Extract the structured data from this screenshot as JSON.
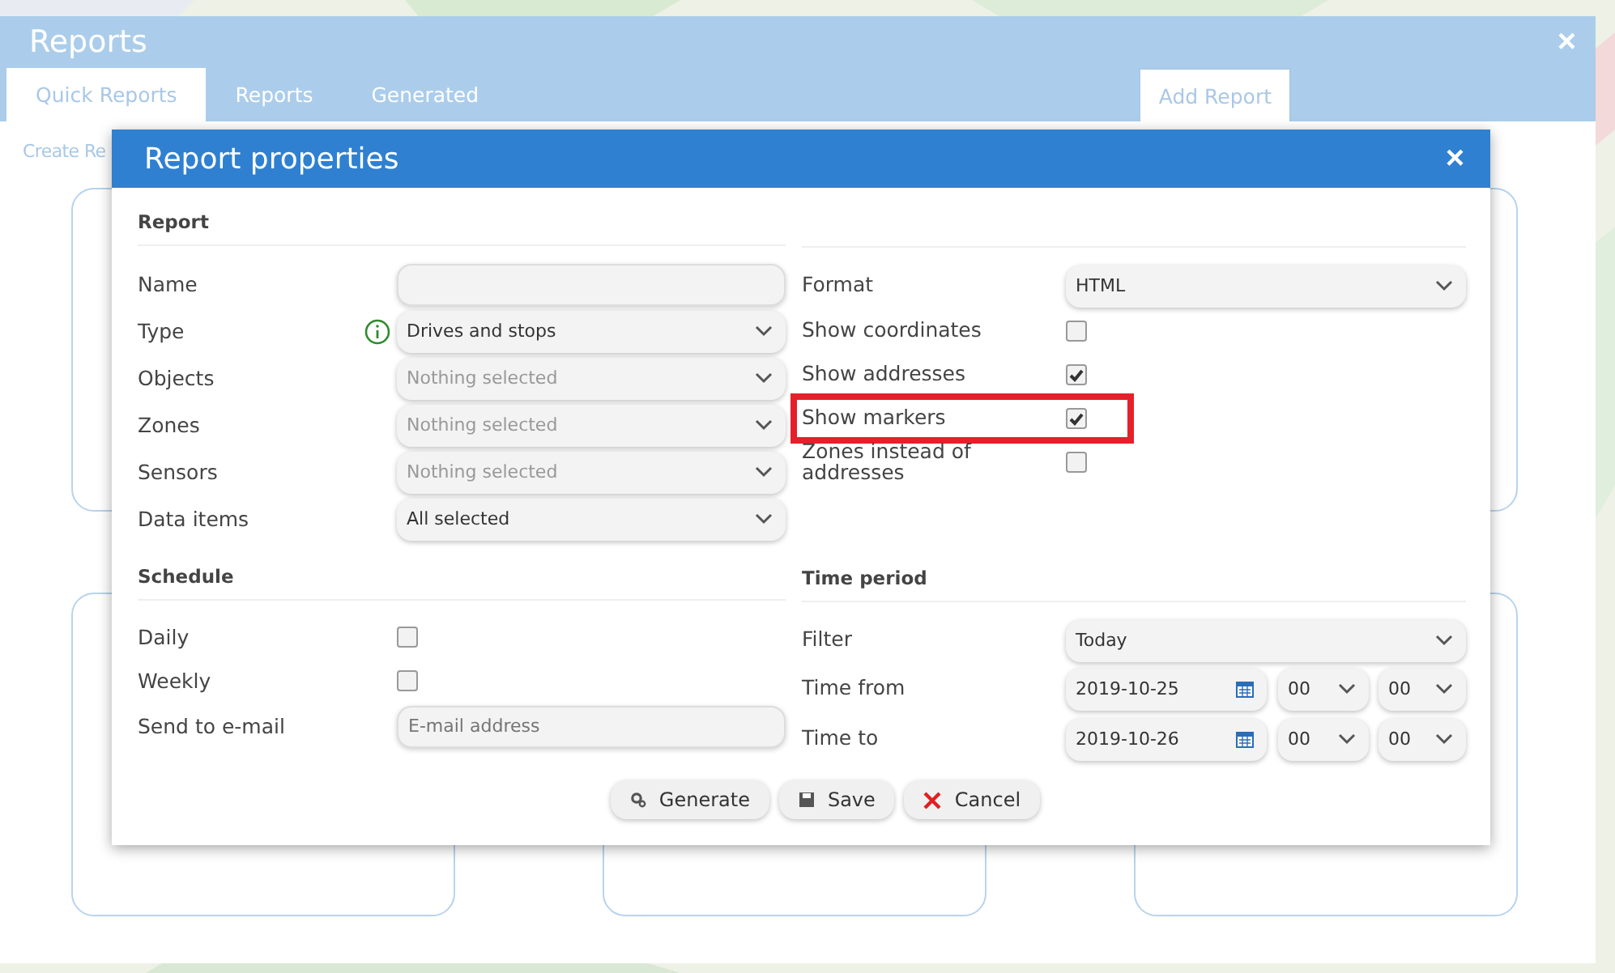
{
  "window": {
    "title": "Reports",
    "close": "×"
  },
  "tabs": [
    {
      "label": "Quick Reports",
      "selected": true
    },
    {
      "label": "Reports",
      "selected": false
    },
    {
      "label": "Generated",
      "selected": false
    }
  ],
  "add_button": "Add Report",
  "create_link": "Create Re",
  "cards": [
    {
      "kind": "card"
    },
    {
      "kind": "card"
    },
    {
      "kind": "card"
    },
    {
      "kind": "card"
    },
    {
      "kind": "card"
    }
  ],
  "dialog": {
    "title": "Report properties",
    "close": "×",
    "report_section": "Report",
    "report_fields": [
      {
        "label": "Name",
        "kind": "input",
        "info": false
      },
      {
        "label": "Type",
        "kind": "select",
        "value": "Drives and stops",
        "muted": false,
        "info": true
      },
      {
        "label": "Objects",
        "kind": "select",
        "value": "Nothing selected",
        "muted": true,
        "info": false
      },
      {
        "label": "Zones",
        "kind": "select",
        "value": "Nothing selected",
        "muted": true,
        "info": false
      },
      {
        "label": "Sensors",
        "kind": "select",
        "value": "Nothing selected",
        "muted": true,
        "info": false
      },
      {
        "label": "Data items",
        "kind": "select",
        "value": "All selected",
        "muted": false,
        "info": false
      }
    ],
    "format": {
      "label": "Format",
      "value": "HTML"
    },
    "options": [
      {
        "label": "Show coordinates",
        "checked": false,
        "highlighted": false
      },
      {
        "label": "Show addresses",
        "checked": true,
        "highlighted": false
      },
      {
        "label": "Show markers",
        "checked": true,
        "highlighted": true
      },
      {
        "label": "Zones instead of addresses",
        "checked": false,
        "highlighted": false
      }
    ],
    "schedule_section": "Schedule",
    "schedule": [
      {
        "label": "Daily",
        "checked": false
      },
      {
        "label": "Weekly",
        "checked": false
      }
    ],
    "email": {
      "label": "Send to e-mail",
      "placeholder": "E-mail address"
    },
    "period_section": "Time period",
    "filter": {
      "label": "Filter",
      "value": "Today"
    },
    "times": [
      {
        "label": "Time from",
        "date": "2019-10-25",
        "hour": "00",
        "minute": "00"
      },
      {
        "label": "Time to",
        "date": "2019-10-26",
        "hour": "00",
        "minute": "00"
      }
    ],
    "buttons": [
      {
        "label": "Generate",
        "kind": "generate"
      },
      {
        "label": "Save",
        "kind": "save"
      },
      {
        "label": "Cancel",
        "kind": "cancel"
      }
    ]
  }
}
